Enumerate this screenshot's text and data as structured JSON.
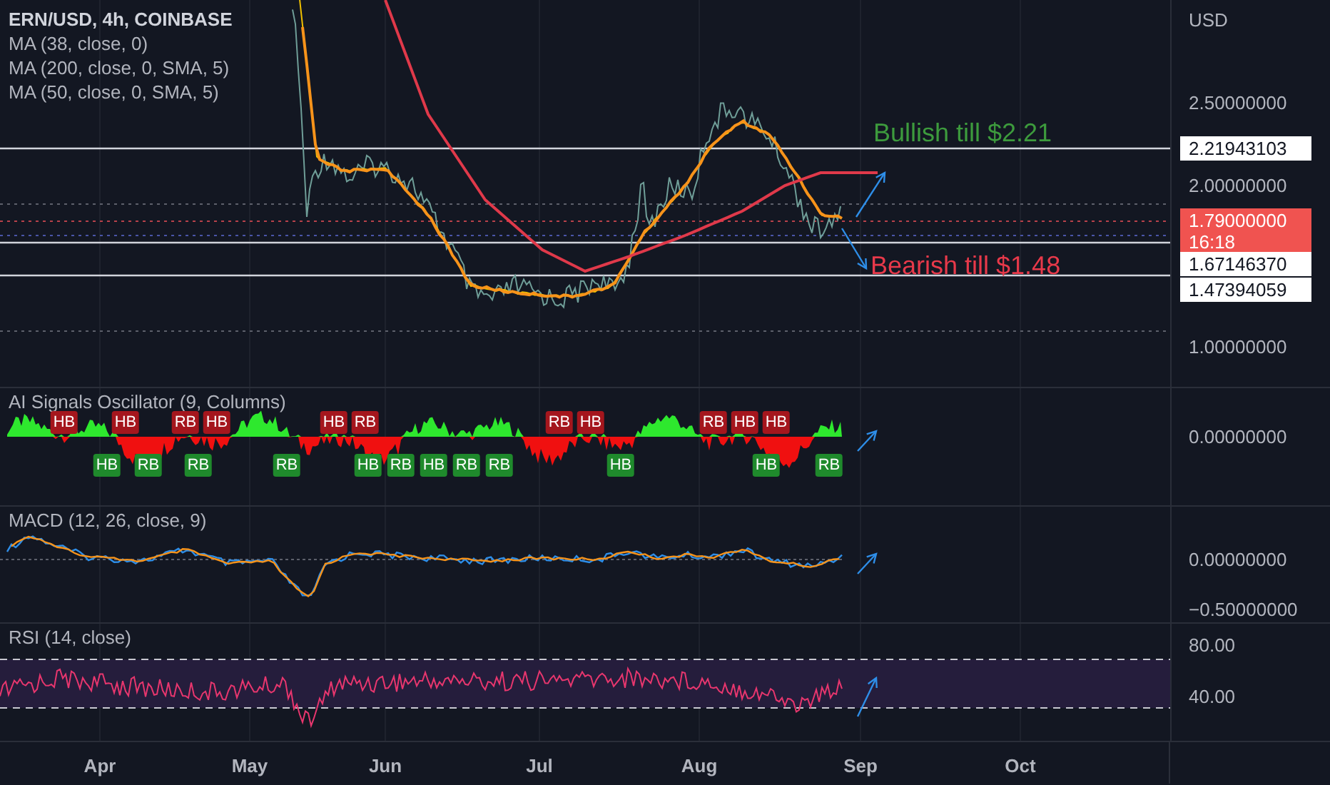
{
  "header": {
    "symbol": "ERN/USD, 4h, COINBASE",
    "indicators": [
      "MA (38, close, 0)",
      "MA (200, close, 0, SMA, 5)",
      "MA (50, close, 0, SMA, 5)"
    ]
  },
  "price_axis": {
    "currency": "USD",
    "ticks": [
      "2.50000000",
      "2.00000000",
      "1.00000000"
    ]
  },
  "price_labels": [
    {
      "text": "2.21943103",
      "kind": "level"
    },
    {
      "text": "1.79000000",
      "countdown": "16:18",
      "kind": "last"
    },
    {
      "text": "1.67146370",
      "kind": "level"
    },
    {
      "text": "1.47394059",
      "kind": "level"
    }
  ],
  "annotations": [
    {
      "text": "Bullish till $2.21",
      "color": "#3d9b3d"
    },
    {
      "text": "Bearish till $1.48",
      "color": "#e8394a"
    }
  ],
  "oscillator": {
    "title": "AI Signals Oscillator (9, Columns)",
    "tick": "0.00000000",
    "signals": [
      {
        "label": "HB",
        "kind": "top"
      },
      {
        "label": "HB",
        "kind": "top"
      },
      {
        "label": "RB",
        "kind": "top"
      },
      {
        "label": "HB",
        "kind": "top"
      },
      {
        "label": "HB",
        "kind": "top"
      },
      {
        "label": "RB",
        "kind": "top"
      },
      {
        "label": "RB",
        "kind": "top"
      },
      {
        "label": "HB",
        "kind": "top"
      },
      {
        "label": "RB",
        "kind": "top"
      },
      {
        "label": "HB",
        "kind": "top"
      },
      {
        "label": "HB",
        "kind": "top"
      },
      {
        "label": "HB",
        "kind": "bottom"
      },
      {
        "label": "RB",
        "kind": "bottom"
      },
      {
        "label": "RB",
        "kind": "bottom"
      },
      {
        "label": "RB",
        "kind": "bottom"
      },
      {
        "label": "HB",
        "kind": "bottom"
      },
      {
        "label": "RB",
        "kind": "bottom"
      },
      {
        "label": "HB",
        "kind": "bottom"
      },
      {
        "label": "RB",
        "kind": "bottom"
      },
      {
        "label": "RB",
        "kind": "bottom"
      },
      {
        "label": "HB",
        "kind": "bottom"
      },
      {
        "label": "HB",
        "kind": "bottom"
      },
      {
        "label": "RB",
        "kind": "bottom"
      }
    ]
  },
  "macd": {
    "title": "MACD (12, 26, close, 9)",
    "ticks": [
      "0.00000000",
      "−0.50000000"
    ]
  },
  "rsi": {
    "title": "RSI (14, close)",
    "ticks": [
      "80.00",
      "40.00"
    ]
  },
  "time_axis": [
    "Apr",
    "May",
    "Jun",
    "Jul",
    "Aug",
    "Sep",
    "Oct"
  ]
}
